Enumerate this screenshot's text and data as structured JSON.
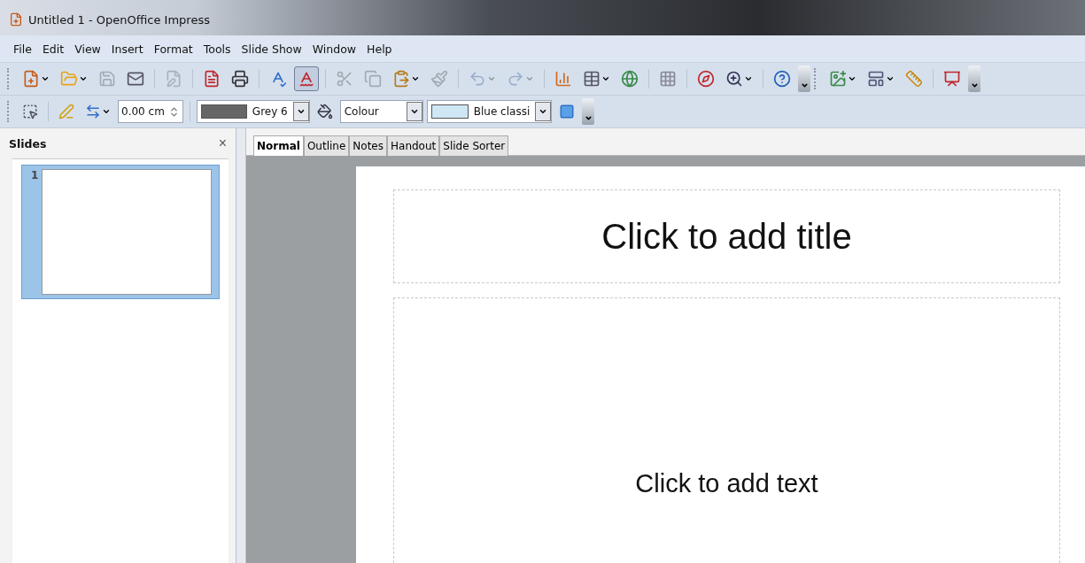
{
  "window": {
    "title": "Untitled 1 - OpenOffice Impress"
  },
  "menu": [
    {
      "label": "File"
    },
    {
      "label": "Edit"
    },
    {
      "label": "View"
    },
    {
      "label": "Insert"
    },
    {
      "label": "Format"
    },
    {
      "label": "Tools"
    },
    {
      "label": "Slide Show"
    },
    {
      "label": "Window"
    },
    {
      "label": "Help"
    }
  ],
  "standard_toolbar": [
    {
      "kind": "button",
      "disabled": false,
      "dropdown": true,
      "pressed": false
    },
    {
      "kind": "button",
      "disabled": false,
      "dropdown": true,
      "pressed": false
    },
    {
      "kind": "button",
      "disabled": true,
      "dropdown": false,
      "pressed": false
    },
    {
      "kind": "button",
      "disabled": false,
      "dropdown": false,
      "pressed": false
    },
    {
      "kind": "separator"
    },
    {
      "kind": "button",
      "disabled": true,
      "dropdown": false,
      "pressed": false
    },
    {
      "kind": "separator"
    },
    {
      "kind": "button",
      "disabled": false,
      "dropdown": false,
      "pressed": false
    },
    {
      "kind": "button",
      "disabled": false,
      "dropdown": false,
      "pressed": false
    },
    {
      "kind": "separator"
    },
    {
      "kind": "button",
      "disabled": false,
      "dropdown": false,
      "pressed": false
    },
    {
      "kind": "button",
      "disabled": false,
      "dropdown": false,
      "pressed": true
    },
    {
      "kind": "separator"
    },
    {
      "kind": "button",
      "disabled": true,
      "dropdown": false,
      "pressed": false
    },
    {
      "kind": "button",
      "disabled": true,
      "dropdown": false,
      "pressed": false
    },
    {
      "kind": "button",
      "disabled": false,
      "dropdown": true,
      "pressed": false
    },
    {
      "kind": "button",
      "disabled": true,
      "dropdown": false,
      "pressed": false
    },
    {
      "kind": "separator"
    },
    {
      "kind": "button",
      "disabled": true,
      "dropdown": true,
      "pressed": false
    },
    {
      "kind": "button",
      "disabled": true,
      "dropdown": true,
      "pressed": false
    },
    {
      "kind": "separator"
    },
    {
      "kind": "button",
      "disabled": false,
      "dropdown": false,
      "pressed": false
    },
    {
      "kind": "button",
      "disabled": false,
      "dropdown": true,
      "pressed": false
    },
    {
      "kind": "button",
      "disabled": false,
      "dropdown": false,
      "pressed": false
    },
    {
      "kind": "separator"
    },
    {
      "kind": "button",
      "disabled": false,
      "dropdown": false,
      "pressed": false
    },
    {
      "kind": "separator"
    },
    {
      "kind": "button",
      "disabled": false,
      "dropdown": false,
      "pressed": false
    },
    {
      "kind": "button",
      "disabled": false,
      "dropdown": true,
      "pressed": false
    },
    {
      "kind": "separator"
    },
    {
      "kind": "button",
      "disabled": false,
      "dropdown": false,
      "pressed": false
    },
    {
      "kind": "overflow"
    }
  ],
  "presentation_toolbar": [
    {
      "kind": "button",
      "disabled": false,
      "dropdown": true,
      "pressed": false
    },
    {
      "kind": "button",
      "disabled": false,
      "dropdown": true,
      "pressed": false
    },
    {
      "kind": "button",
      "disabled": false,
      "dropdown": false,
      "pressed": false
    },
    {
      "kind": "separator"
    },
    {
      "kind": "button",
      "disabled": false,
      "dropdown": false,
      "pressed": false
    },
    {
      "kind": "overflow"
    }
  ],
  "line_toolbar": {
    "line_width": "0.00 cm",
    "line_color": {
      "label": "Grey 6",
      "color": "#666666"
    },
    "area_style": "Colour",
    "area_fill": {
      "label": "Blue classi",
      "color": "#cfe7f5"
    }
  },
  "slides_panel": {
    "title": "Slides",
    "close": "×",
    "slides": [
      {
        "number": "1",
        "selected": true
      }
    ]
  },
  "view_tabs": [
    {
      "label": "Normal",
      "selected": true
    },
    {
      "label": "Outline",
      "selected": false
    },
    {
      "label": "Notes",
      "selected": false
    },
    {
      "label": "Handout",
      "selected": false
    },
    {
      "label": "Slide Sorter",
      "selected": false
    }
  ],
  "slide": {
    "title_placeholder": "Click to add title",
    "text_placeholder": "Click to add text"
  }
}
